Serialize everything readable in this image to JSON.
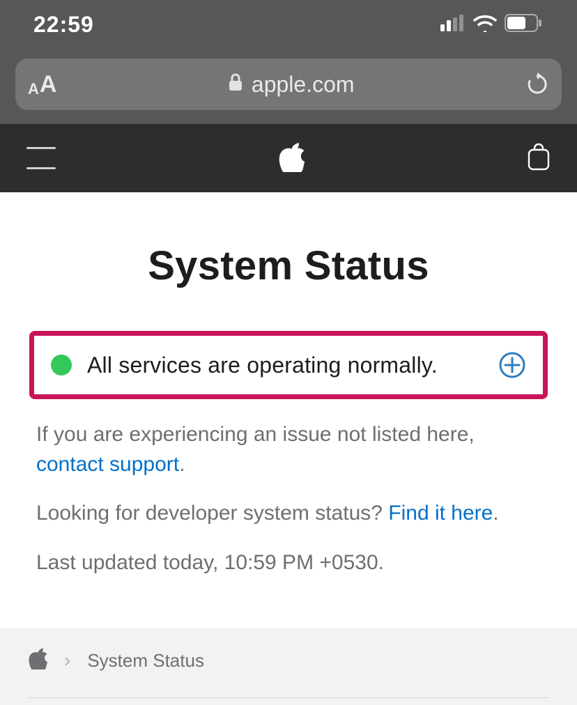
{
  "status_bar": {
    "time": "22:59"
  },
  "url_bar": {
    "domain": "apple.com"
  },
  "page": {
    "title": "System Status",
    "status_summary": "All services are operating normally.",
    "issue_prefix": "If you are experiencing an issue not listed here, ",
    "contact_link": "contact support",
    "issue_suffix": ".",
    "dev_prefix": "Looking for developer system status? ",
    "dev_link": "Find it here",
    "dev_suffix": ".",
    "last_updated": "Last updated today, 10:59 PM +0530."
  },
  "breadcrumb": {
    "current": "System Status"
  }
}
